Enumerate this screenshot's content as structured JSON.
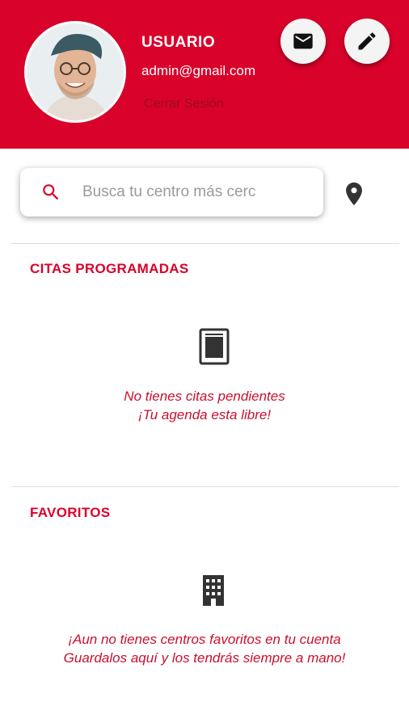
{
  "header": {
    "user_name": "USUARIO",
    "email": "admin@gmail.com",
    "logout_label": "Cerrar Sesión",
    "mail_button_icon": "mail-icon",
    "edit_button_icon": "edit-icon",
    "background_color": "#d9022b"
  },
  "search": {
    "placeholder": "Busca tu centro más cercano",
    "search_icon": "search-icon",
    "location_icon": "location-pin-icon"
  },
  "appointments": {
    "title": "CITAS PROGRAMADAS",
    "empty_icon": "document-icon",
    "empty_line1": "No tienes citas pendientes",
    "empty_line2": "¡Tu agenda esta libre!"
  },
  "favorites": {
    "title": "FAVORITOS",
    "empty_icon": "building-icon",
    "empty_line1": "¡Aun no tienes centros favoritos en tu cuenta",
    "empty_line2": "Guardalos aquí y los tendrás siempre a mano!"
  },
  "colors": {
    "accent": "#d9022b",
    "empty_text": "#c8102e",
    "icon_dark": "#333333"
  }
}
